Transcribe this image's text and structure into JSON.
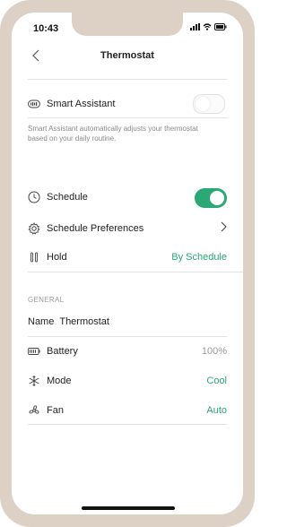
{
  "status": {
    "time": "10:43"
  },
  "nav": {
    "title": "Thermostat"
  },
  "smart_assistant": {
    "label": "Smart Assistant",
    "description": "Smart Assistant automatically adjusts your thermostat based on your daily routine.",
    "enabled": false
  },
  "schedule": {
    "label": "Schedule",
    "enabled": true
  },
  "schedule_preferences": {
    "label": "Schedule Preferences"
  },
  "hold": {
    "label": "Hold",
    "value": "By Schedule"
  },
  "general": {
    "section_title": "GENERAL",
    "name_label": "Name",
    "name_value": "Thermostat",
    "battery_label": "Battery",
    "battery_value": "100%",
    "mode_label": "Mode",
    "mode_value": "Cool",
    "fan_label": "Fan",
    "fan_value": "Auto"
  },
  "colors": {
    "accent": "#2aa876",
    "frame": "#ddd1c6"
  }
}
